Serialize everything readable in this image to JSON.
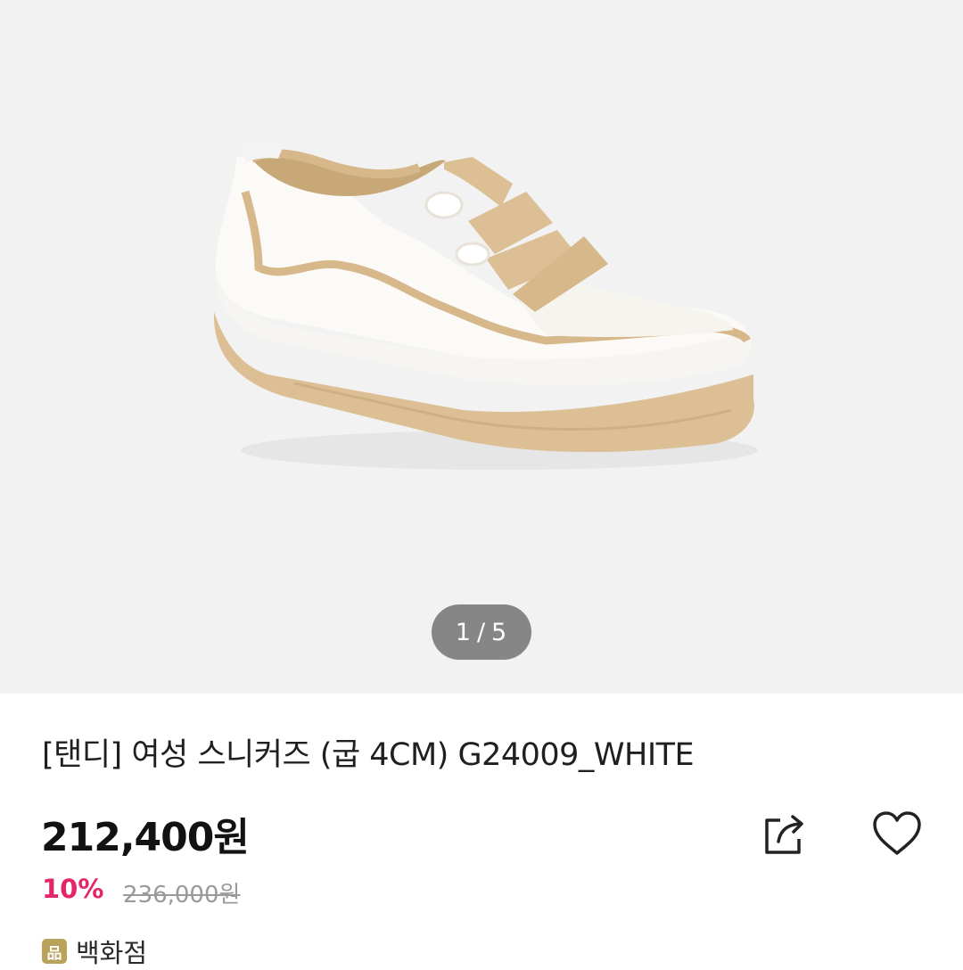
{
  "gallery": {
    "current_page": "1",
    "separator": "/",
    "total_pages": "5",
    "image": "white-sneaker-with-beige-straps"
  },
  "product": {
    "title": "[탠디] 여성 스니커즈 (굽 4CM) G24009_WHITE",
    "price": "212,400원",
    "discount_rate": "10%",
    "original_price": "236,000원"
  },
  "store": {
    "icon_glyph": "品",
    "label": "백화점"
  },
  "icons": {
    "share": "share-icon",
    "like": "heart-icon",
    "store": "department-store-icon"
  },
  "colors": {
    "discount": "#e4266a",
    "sole": "#dcbf94",
    "store_icon": "#b9a25a"
  }
}
